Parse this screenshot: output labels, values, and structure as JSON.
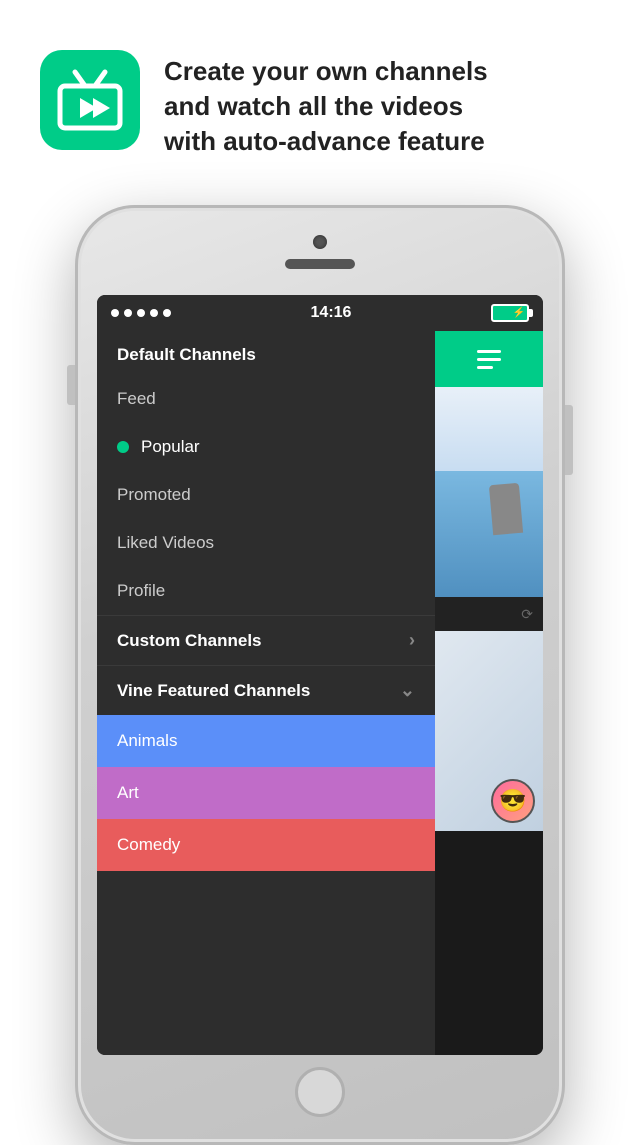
{
  "app": {
    "icon_alt": "fast-forward icon",
    "tagline": "Create your own channels\nand watch all the videos\nwith auto-advance feature"
  },
  "status_bar": {
    "time": "14:16",
    "signal_dots": 5
  },
  "header": {
    "menu_icon": "hamburger-menu"
  },
  "menu": {
    "default_channels_label": "Default Channels",
    "items": [
      {
        "id": "feed",
        "label": "Feed",
        "active": false,
        "has_dot": false
      },
      {
        "id": "popular",
        "label": "Popular",
        "active": true,
        "has_dot": true
      },
      {
        "id": "promoted",
        "label": "Promoted",
        "active": false,
        "has_dot": false
      },
      {
        "id": "liked-videos",
        "label": "Liked Videos",
        "active": false,
        "has_dot": false
      },
      {
        "id": "profile",
        "label": "Profile",
        "active": false,
        "has_dot": false
      }
    ],
    "custom_channels_label": "Custom Channels",
    "custom_channels_arrow": ">",
    "vine_featured_label": "Vine Featured Channels",
    "vine_featured_arrow": "v",
    "channels": [
      {
        "id": "animals",
        "label": "Animals",
        "color": "#5b8ff9"
      },
      {
        "id": "art",
        "label": "Art",
        "color": "#c06cc8"
      },
      {
        "id": "comedy",
        "label": "Comedy",
        "color": "#e85c5c"
      }
    ]
  }
}
